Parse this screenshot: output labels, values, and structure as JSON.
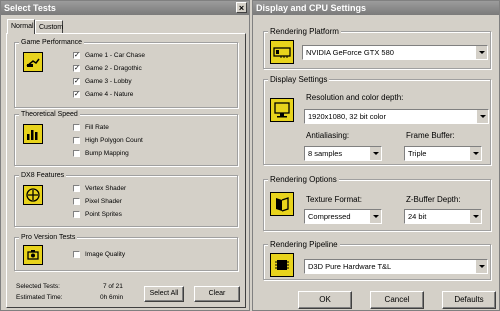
{
  "left": {
    "title": "Select Tests",
    "tabs": [
      "Normal",
      "Custom"
    ],
    "groups": {
      "game": {
        "label": "Game Performance",
        "items": [
          "Game 1 - Car Chase",
          "Game 2 - Dragothic",
          "Game 3 - Lobby",
          "Game 4 - Nature"
        ]
      },
      "theory": {
        "label": "Theoretical Speed",
        "items": [
          "Fill Rate",
          "High Polygon Count",
          "Bump Mapping"
        ]
      },
      "dx8": {
        "label": "DX8 Features",
        "items": [
          "Vertex Shader",
          "Pixel Shader",
          "Point Sprites"
        ]
      },
      "pro": {
        "label": "Pro Version Tests",
        "items": [
          "Image Quality"
        ]
      }
    },
    "check_mark": "✓",
    "selected_label": "Selected Tests:",
    "selected_value": "7 of 21",
    "estimated_label": "Estimated Time:",
    "estimated_value": "0h 6min",
    "select_all": "Select All",
    "clear": "Clear"
  },
  "right": {
    "title": "Display and CPU Settings",
    "platform": {
      "label": "Rendering Platform",
      "value": "NVIDIA GeForce GTX 580"
    },
    "display": {
      "label": "Display Settings",
      "res_label": "Resolution and color depth:",
      "res_value": "1920x1080, 32 bit color",
      "aa_label": "Antialiasing:",
      "aa_value": "8 samples",
      "fb_label": "Frame Buffer:",
      "fb_value": "Triple"
    },
    "options": {
      "label": "Rendering Options",
      "tex_label": "Texture Format:",
      "tex_value": "Compressed",
      "zb_label": "Z-Buffer Depth:",
      "zb_value": "24 bit"
    },
    "pipeline": {
      "label": "Rendering Pipeline",
      "value": "D3D Pure Hardware T&L"
    },
    "ok": "OK",
    "cancel": "Cancel",
    "defaults": "Defaults"
  },
  "close_glyph": "×"
}
